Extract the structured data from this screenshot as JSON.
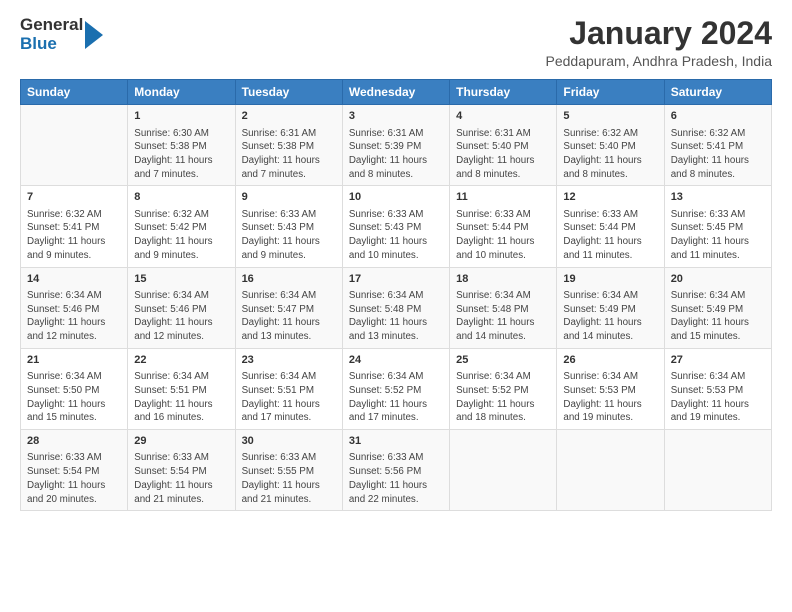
{
  "header": {
    "logo_general": "General",
    "logo_blue": "Blue",
    "month_title": "January 2024",
    "location": "Peddapuram, Andhra Pradesh, India"
  },
  "days_of_week": [
    "Sunday",
    "Monday",
    "Tuesday",
    "Wednesday",
    "Thursday",
    "Friday",
    "Saturday"
  ],
  "weeks": [
    [
      {
        "day": "",
        "sunrise": "",
        "sunset": "",
        "daylight": ""
      },
      {
        "day": "1",
        "sunrise": "Sunrise: 6:30 AM",
        "sunset": "Sunset: 5:38 PM",
        "daylight": "Daylight: 11 hours and 7 minutes."
      },
      {
        "day": "2",
        "sunrise": "Sunrise: 6:31 AM",
        "sunset": "Sunset: 5:38 PM",
        "daylight": "Daylight: 11 hours and 7 minutes."
      },
      {
        "day": "3",
        "sunrise": "Sunrise: 6:31 AM",
        "sunset": "Sunset: 5:39 PM",
        "daylight": "Daylight: 11 hours and 8 minutes."
      },
      {
        "day": "4",
        "sunrise": "Sunrise: 6:31 AM",
        "sunset": "Sunset: 5:40 PM",
        "daylight": "Daylight: 11 hours and 8 minutes."
      },
      {
        "day": "5",
        "sunrise": "Sunrise: 6:32 AM",
        "sunset": "Sunset: 5:40 PM",
        "daylight": "Daylight: 11 hours and 8 minutes."
      },
      {
        "day": "6",
        "sunrise": "Sunrise: 6:32 AM",
        "sunset": "Sunset: 5:41 PM",
        "daylight": "Daylight: 11 hours and 8 minutes."
      }
    ],
    [
      {
        "day": "7",
        "sunrise": "Sunrise: 6:32 AM",
        "sunset": "Sunset: 5:41 PM",
        "daylight": "Daylight: 11 hours and 9 minutes."
      },
      {
        "day": "8",
        "sunrise": "Sunrise: 6:32 AM",
        "sunset": "Sunset: 5:42 PM",
        "daylight": "Daylight: 11 hours and 9 minutes."
      },
      {
        "day": "9",
        "sunrise": "Sunrise: 6:33 AM",
        "sunset": "Sunset: 5:43 PM",
        "daylight": "Daylight: 11 hours and 9 minutes."
      },
      {
        "day": "10",
        "sunrise": "Sunrise: 6:33 AM",
        "sunset": "Sunset: 5:43 PM",
        "daylight": "Daylight: 11 hours and 10 minutes."
      },
      {
        "day": "11",
        "sunrise": "Sunrise: 6:33 AM",
        "sunset": "Sunset: 5:44 PM",
        "daylight": "Daylight: 11 hours and 10 minutes."
      },
      {
        "day": "12",
        "sunrise": "Sunrise: 6:33 AM",
        "sunset": "Sunset: 5:44 PM",
        "daylight": "Daylight: 11 hours and 11 minutes."
      },
      {
        "day": "13",
        "sunrise": "Sunrise: 6:33 AM",
        "sunset": "Sunset: 5:45 PM",
        "daylight": "Daylight: 11 hours and 11 minutes."
      }
    ],
    [
      {
        "day": "14",
        "sunrise": "Sunrise: 6:34 AM",
        "sunset": "Sunset: 5:46 PM",
        "daylight": "Daylight: 11 hours and 12 minutes."
      },
      {
        "day": "15",
        "sunrise": "Sunrise: 6:34 AM",
        "sunset": "Sunset: 5:46 PM",
        "daylight": "Daylight: 11 hours and 12 minutes."
      },
      {
        "day": "16",
        "sunrise": "Sunrise: 6:34 AM",
        "sunset": "Sunset: 5:47 PM",
        "daylight": "Daylight: 11 hours and 13 minutes."
      },
      {
        "day": "17",
        "sunrise": "Sunrise: 6:34 AM",
        "sunset": "Sunset: 5:48 PM",
        "daylight": "Daylight: 11 hours and 13 minutes."
      },
      {
        "day": "18",
        "sunrise": "Sunrise: 6:34 AM",
        "sunset": "Sunset: 5:48 PM",
        "daylight": "Daylight: 11 hours and 14 minutes."
      },
      {
        "day": "19",
        "sunrise": "Sunrise: 6:34 AM",
        "sunset": "Sunset: 5:49 PM",
        "daylight": "Daylight: 11 hours and 14 minutes."
      },
      {
        "day": "20",
        "sunrise": "Sunrise: 6:34 AM",
        "sunset": "Sunset: 5:49 PM",
        "daylight": "Daylight: 11 hours and 15 minutes."
      }
    ],
    [
      {
        "day": "21",
        "sunrise": "Sunrise: 6:34 AM",
        "sunset": "Sunset: 5:50 PM",
        "daylight": "Daylight: 11 hours and 15 minutes."
      },
      {
        "day": "22",
        "sunrise": "Sunrise: 6:34 AM",
        "sunset": "Sunset: 5:51 PM",
        "daylight": "Daylight: 11 hours and 16 minutes."
      },
      {
        "day": "23",
        "sunrise": "Sunrise: 6:34 AM",
        "sunset": "Sunset: 5:51 PM",
        "daylight": "Daylight: 11 hours and 17 minutes."
      },
      {
        "day": "24",
        "sunrise": "Sunrise: 6:34 AM",
        "sunset": "Sunset: 5:52 PM",
        "daylight": "Daylight: 11 hours and 17 minutes."
      },
      {
        "day": "25",
        "sunrise": "Sunrise: 6:34 AM",
        "sunset": "Sunset: 5:52 PM",
        "daylight": "Daylight: 11 hours and 18 minutes."
      },
      {
        "day": "26",
        "sunrise": "Sunrise: 6:34 AM",
        "sunset": "Sunset: 5:53 PM",
        "daylight": "Daylight: 11 hours and 19 minutes."
      },
      {
        "day": "27",
        "sunrise": "Sunrise: 6:34 AM",
        "sunset": "Sunset: 5:53 PM",
        "daylight": "Daylight: 11 hours and 19 minutes."
      }
    ],
    [
      {
        "day": "28",
        "sunrise": "Sunrise: 6:33 AM",
        "sunset": "Sunset: 5:54 PM",
        "daylight": "Daylight: 11 hours and 20 minutes."
      },
      {
        "day": "29",
        "sunrise": "Sunrise: 6:33 AM",
        "sunset": "Sunset: 5:54 PM",
        "daylight": "Daylight: 11 hours and 21 minutes."
      },
      {
        "day": "30",
        "sunrise": "Sunrise: 6:33 AM",
        "sunset": "Sunset: 5:55 PM",
        "daylight": "Daylight: 11 hours and 21 minutes."
      },
      {
        "day": "31",
        "sunrise": "Sunrise: 6:33 AM",
        "sunset": "Sunset: 5:56 PM",
        "daylight": "Daylight: 11 hours and 22 minutes."
      },
      {
        "day": "",
        "sunrise": "",
        "sunset": "",
        "daylight": ""
      },
      {
        "day": "",
        "sunrise": "",
        "sunset": "",
        "daylight": ""
      },
      {
        "day": "",
        "sunrise": "",
        "sunset": "",
        "daylight": ""
      }
    ]
  ]
}
